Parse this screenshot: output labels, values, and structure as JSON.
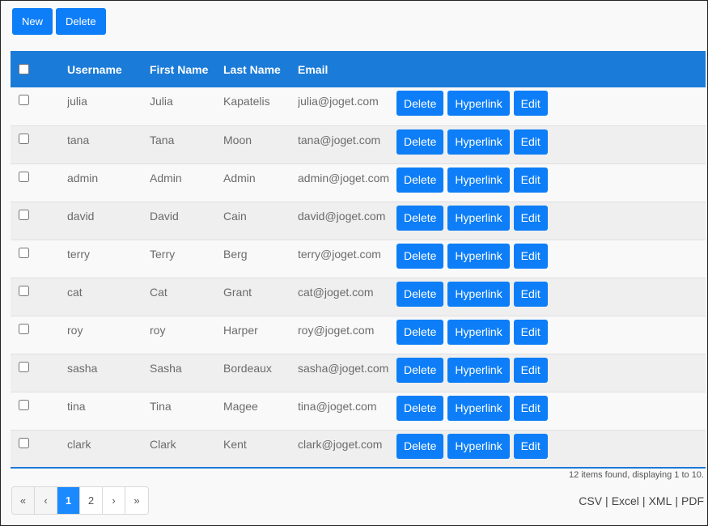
{
  "toolbar": {
    "new_label": "New",
    "delete_label": "Delete"
  },
  "table": {
    "headers": {
      "username": "Username",
      "first_name": "First Name",
      "last_name": "Last Name",
      "email": "Email"
    },
    "actions": {
      "delete": "Delete",
      "hyperlink": "Hyperlink",
      "edit": "Edit"
    },
    "rows": [
      {
        "username": "julia",
        "first_name": "Julia",
        "last_name": "Kapatelis",
        "email": "julia@joget.com"
      },
      {
        "username": "tana",
        "first_name": "Tana",
        "last_name": "Moon",
        "email": "tana@joget.com"
      },
      {
        "username": "admin",
        "first_name": "Admin",
        "last_name": "Admin",
        "email": "admin@joget.com"
      },
      {
        "username": "david",
        "first_name": "David",
        "last_name": "Cain",
        "email": "david@joget.com"
      },
      {
        "username": "terry",
        "first_name": "Terry",
        "last_name": "Berg",
        "email": "terry@joget.com"
      },
      {
        "username": "cat",
        "first_name": "Cat",
        "last_name": "Grant",
        "email": "cat@joget.com"
      },
      {
        "username": "roy",
        "first_name": "roy",
        "last_name": "Harper",
        "email": "roy@joget.com"
      },
      {
        "username": "sasha",
        "first_name": "Sasha",
        "last_name": "Bordeaux",
        "email": "sasha@joget.com"
      },
      {
        "username": "tina",
        "first_name": "Tina",
        "last_name": "Magee",
        "email": "tina@joget.com"
      },
      {
        "username": "clark",
        "first_name": "Clark",
        "last_name": "Kent",
        "email": "clark@joget.com"
      }
    ]
  },
  "summary": "12 items found, displaying 1 to 10.",
  "pagination": {
    "first": "«",
    "prev": "‹",
    "pages": [
      "1",
      "2"
    ],
    "current": "1",
    "next": "›",
    "last": "»"
  },
  "exports": {
    "csv": "CSV",
    "excel": "Excel",
    "xml": "XML",
    "pdf": "PDF",
    "separator": "|"
  },
  "colors": {
    "primary": "#0d7ef7",
    "header_bg": "#1b7bd8"
  }
}
